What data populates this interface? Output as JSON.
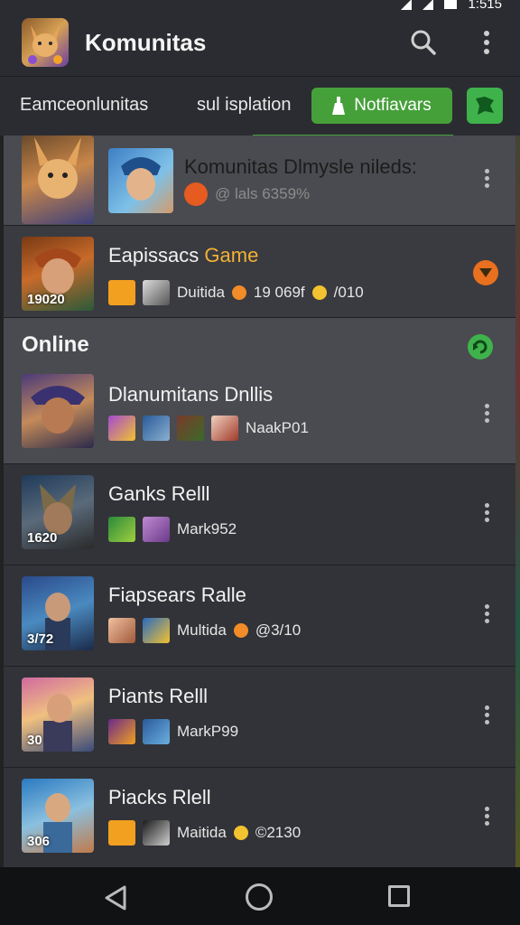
{
  "status": {
    "time": "1:515"
  },
  "appbar": {
    "title": "Komunitas"
  },
  "filters": {
    "tab1": "Eamceonlunitas",
    "tab2": "sul isplation",
    "notif_button": "Notfiavars"
  },
  "rows": [
    {
      "title": "Komunitas Dlmysle nileds:",
      "meta": "@ lals 6359%"
    },
    {
      "title_main": "Eapissacs ",
      "title_accent": "Game",
      "badge": "19020",
      "meta_user": "Duitida",
      "meta_count": "19 069f",
      "meta_extra": "/010"
    },
    {
      "section": "Online"
    },
    {
      "title": "Dlanumitans Dnllis",
      "meta_user": "NaakP01"
    },
    {
      "title": "Ganks Relll",
      "badge": "1620",
      "meta_user": "Mark952"
    },
    {
      "title": "Fiapsears Ralle",
      "badge": "3/72",
      "meta_user": "Multida",
      "meta_count": "@3/10"
    },
    {
      "title": "Piants Relll",
      "badge": "30",
      "meta_user": "MarkP99"
    },
    {
      "title": "Piacks Rlell",
      "badge": "306",
      "meta_user": "Maitida",
      "meta_count": "©2130"
    }
  ],
  "colors": {
    "accent_green": "#46a03a",
    "accent_orange": "#f2b134"
  }
}
